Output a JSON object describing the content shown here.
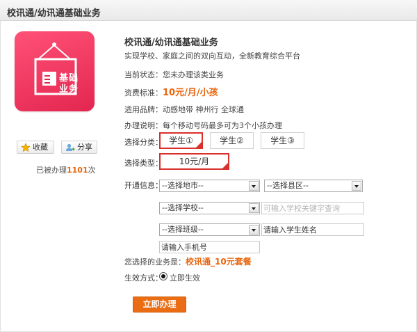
{
  "header": {
    "title": "校讯通/幼讯通基础业务"
  },
  "product": {
    "logo_text": [
      "基础",
      "业务"
    ],
    "actions": {
      "favorite_label": "收藏",
      "share_label": "分享"
    },
    "handled": {
      "prefix": "已被办理",
      "count": "1101",
      "suffix": "次"
    }
  },
  "details": {
    "title": "校讯通/幼讯通基础业务",
    "description": "实现学校、家庭之间的双向互动，全新教育综合平台",
    "status_label": "当前状态：",
    "status_value": "您未办理该类业务",
    "fee_label": "资费标准：",
    "fee_value": "10元/月/小孩",
    "brands_label": "适用品牌：",
    "brands_value": "动感地带 神州行 全球通",
    "note_label": "办理说明：",
    "note_value": "每个移动号码最多可为3个小孩办理"
  },
  "form": {
    "category_label": "选择分类：",
    "categories": [
      "学生①",
      "学生②",
      "学生③"
    ],
    "type_label": "选择类型：",
    "type_value": "10元/月",
    "info_label": "开通信息：",
    "city_select": "--选择地市--",
    "county_select": "--选择县区--",
    "school_select": "--选择学校--",
    "school_keyword_placeholder": "可输入学校关键字查询",
    "class_select": "--选择班级--",
    "student_name_placeholder": "请输入学生姓名",
    "phone_placeholder": "请输入手机号",
    "selected_label": "您选择的业务是：",
    "selected_value": "校讯通_10元套餐",
    "effect_label": "生效方式：",
    "effect_option": "立即生效",
    "submit_label": "立即办理"
  },
  "colors": {
    "accent": "#ea6d14",
    "highlight_border": "#d9302b",
    "logo": "#e8345a"
  },
  "icons": {
    "favorite": "star-icon",
    "share": "share-person-icon"
  }
}
